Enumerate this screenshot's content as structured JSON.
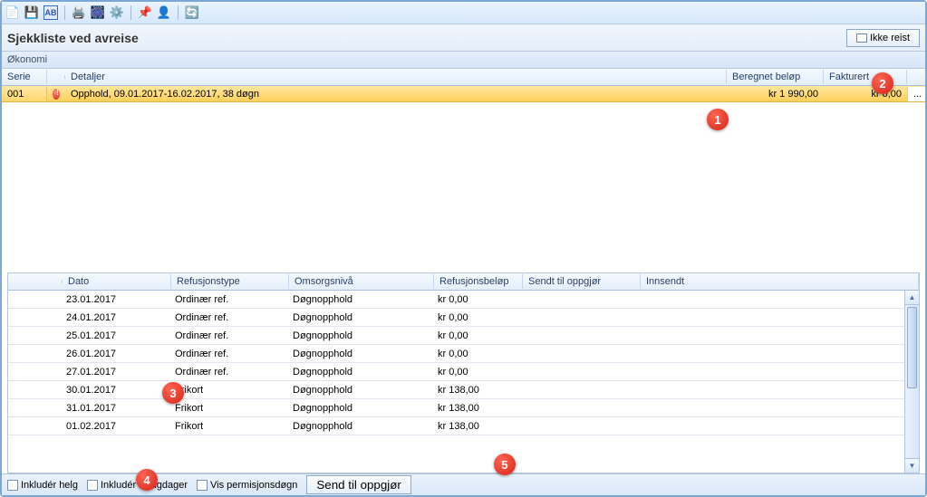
{
  "title": "Sjekkliste ved avreise",
  "button_ikke_reist": "Ikke reist",
  "section": "Økonomi",
  "top_table": {
    "headers": {
      "serie": "Serie",
      "detaljer": "Detaljer",
      "beregnet": "Beregnet beløp",
      "fakturert": "Fakturert"
    },
    "row": {
      "serie": "001",
      "detaljer": "Opphold, 09.01.2017-16.02.2017, 38 døgn",
      "beregnet": "kr 1 990,00",
      "fakturert": "kr 0,00",
      "menu": "..."
    }
  },
  "bottom_table": {
    "headers": {
      "dato": "Dato",
      "refusjonstype": "Refusjonstype",
      "omsorgsniva": "Omsorgsnivå",
      "refusjonsbelop": "Refusjonsbeløp",
      "sendt": "Sendt til oppgjør",
      "innsendt": "Innsendt"
    },
    "rows": [
      {
        "dato": "23.01.2017",
        "refusjon": "Ordinær ref.",
        "omsorg": "Døgnopphold",
        "belop": "kr 0,00",
        "sendt": "",
        "innsendt": ""
      },
      {
        "dato": "24.01.2017",
        "refusjon": "Ordinær ref.",
        "omsorg": "Døgnopphold",
        "belop": "kr 0,00",
        "sendt": "",
        "innsendt": ""
      },
      {
        "dato": "25.01.2017",
        "refusjon": "Ordinær ref.",
        "omsorg": "Døgnopphold",
        "belop": "kr 0,00",
        "sendt": "",
        "innsendt": ""
      },
      {
        "dato": "26.01.2017",
        "refusjon": "Ordinær ref.",
        "omsorg": "Døgnopphold",
        "belop": "kr 0,00",
        "sendt": "",
        "innsendt": ""
      },
      {
        "dato": "27.01.2017",
        "refusjon": "Ordinær ref.",
        "omsorg": "Døgnopphold",
        "belop": "kr 0,00",
        "sendt": "",
        "innsendt": ""
      },
      {
        "dato": "30.01.2017",
        "refusjon": "Frikort",
        "omsorg": "Døgnopphold",
        "belop": "kr 138,00",
        "sendt": "",
        "innsendt": ""
      },
      {
        "dato": "31.01.2017",
        "refusjon": "Frikort",
        "omsorg": "Døgnopphold",
        "belop": "kr 138,00",
        "sendt": "",
        "innsendt": ""
      },
      {
        "dato": "01.02.2017",
        "refusjon": "Frikort",
        "omsorg": "Døgnopphold",
        "belop": "kr 138,00",
        "sendt": "",
        "innsendt": ""
      }
    ]
  },
  "bottom_bar": {
    "chk1": "Inkludér helg",
    "chk2": "Inkludér helligdager",
    "chk3": "Vis permisjonsdøgn",
    "send_btn": "Send til oppgjør"
  },
  "callouts": {
    "1": "1",
    "2": "2",
    "3": "3",
    "4": "4",
    "5": "5"
  }
}
